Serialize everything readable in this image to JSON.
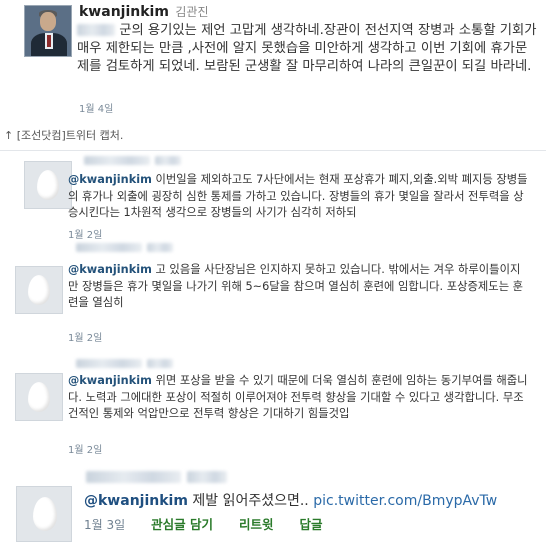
{
  "main_tweet": {
    "username": "kwanjinkim",
    "fullname": "김관진",
    "text_after_blur": " 군의 용기있는 제언 고맙게 생각하네.장관이 전선지역 장병과 소통할 기회가 매우 제한되는 만큼 ,사전에 알지 못했습을 미안하게 생각하고 이번 기회에 휴가문제를 검토하게 되었네. 보람된 군생활 잘 마무리하여 나라의 큰일꾼이 되길 바라네.",
    "time": "1월 4일"
  },
  "caption": "↑ [조선닷컴]트위터 캡처.",
  "replies": [
    {
      "mention": "@kwanjinkim",
      "text": " 이번일을 제외하고도 7사단에서는 현재 포상휴가 폐지,외출.외박 폐지등 장병들의 휴가나 외출에 굉장히 심한 통제를 가하고 있습니다. 장병들의 휴가 몇일을 잘라서 전투력을 상승시킨다는 1차원적 생각으로 장병들의 사기가 심각히 저하되",
      "time": "1월 2일"
    },
    {
      "mention": "@kwanjinkim",
      "text": " 고 있음을 사단장님은 인지하지 못하고 있습니다. 밖에서는 겨우 하루이틀이지만 장병들은 휴가 몇일을 나가기 위해 5~6달을 참으며 열심히 훈련에 임합니다. 포상증제도는 훈련을 열심히",
      "time": "1월 2일"
    },
    {
      "mention": "@kwanjinkim",
      "text": " 위면 포상을 받을 수 있기 때문에 더욱 열심히 훈련에 임하는 동기부여를 해줍니다. 노력과 그에대한 포상이 적절히 이루어져야 전투력 향상을 기대할 수 있다고 생각합니다. 무조건적인 통제와 억압만으로 전투력 향상은 기대하기 힘들것입",
      "time": "1월 2일"
    }
  ],
  "last_tweet": {
    "mention": "@kwanjinkim",
    "text": " 제발 읽어주셨으면.. ",
    "link": "pic.twitter.com/BmypAvTw",
    "time": "1월 3일",
    "actions": [
      "관심글 담기",
      "리트윗",
      "답글"
    ],
    "action_color": "#2a7a2a"
  },
  "icons": [
    "default-egg-avatar-icon",
    "profile-photo"
  ]
}
